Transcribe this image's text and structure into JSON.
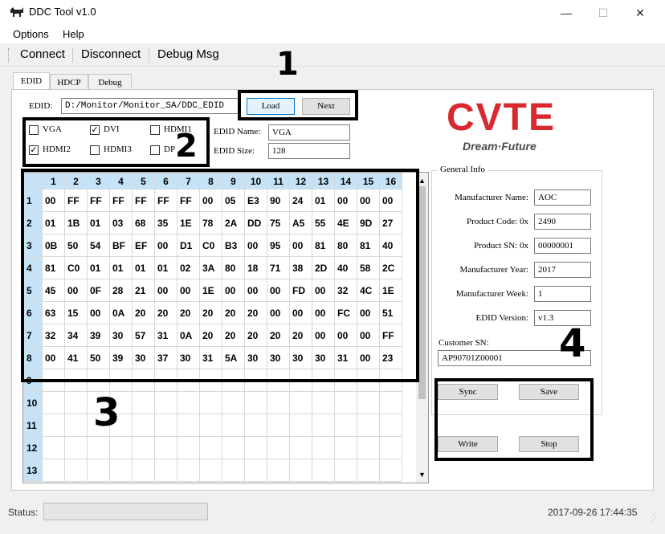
{
  "window": {
    "title": "DDC Tool v1.0",
    "minimize": "—",
    "maximize": "☐",
    "close": "✕"
  },
  "menu": [
    "Options",
    "Help"
  ],
  "toolbar": [
    "Connect",
    "Disconnect",
    "Debug Msg"
  ],
  "tabs": [
    "EDID",
    "HDCP",
    "Debug"
  ],
  "edid": {
    "path_label": "EDID:",
    "path_value": "D:/Monitor/Monitor_SA/DDC_EDID",
    "load": "Load",
    "next": "Next",
    "name_label": "EDID Name:",
    "name_value": "VGA",
    "size_label": "EDID Size:",
    "size_value": "128"
  },
  "ports": [
    {
      "label": "VGA",
      "checked": false
    },
    {
      "label": "DVI",
      "checked": true
    },
    {
      "label": "HDMI1",
      "checked": false
    },
    {
      "label": "HDMI2",
      "checked": true
    },
    {
      "label": "HDMI3",
      "checked": false
    },
    {
      "label": "DP",
      "checked": false
    }
  ],
  "logo": {
    "brand": "CVTE",
    "tagline": "Dream·Future",
    "color": "#d9282f"
  },
  "grid": {
    "columns": [
      "1",
      "2",
      "3",
      "4",
      "5",
      "6",
      "7",
      "8",
      "9",
      "10",
      "11",
      "12",
      "13",
      "14",
      "15",
      "16"
    ],
    "rows": [
      {
        "label": "1",
        "cells": [
          "00",
          "FF",
          "FF",
          "FF",
          "FF",
          "FF",
          "FF",
          "00",
          "05",
          "E3",
          "90",
          "24",
          "01",
          "00",
          "00",
          "00"
        ]
      },
      {
        "label": "2",
        "cells": [
          "01",
          "1B",
          "01",
          "03",
          "68",
          "35",
          "1E",
          "78",
          "2A",
          "DD",
          "75",
          "A5",
          "55",
          "4E",
          "9D",
          "27"
        ]
      },
      {
        "label": "3",
        "cells": [
          "0B",
          "50",
          "54",
          "BF",
          "EF",
          "00",
          "D1",
          "C0",
          "B3",
          "00",
          "95",
          "00",
          "81",
          "80",
          "81",
          "40"
        ]
      },
      {
        "label": "4",
        "cells": [
          "81",
          "C0",
          "01",
          "01",
          "01",
          "01",
          "02",
          "3A",
          "80",
          "18",
          "71",
          "38",
          "2D",
          "40",
          "58",
          "2C"
        ]
      },
      {
        "label": "5",
        "cells": [
          "45",
          "00",
          "0F",
          "28",
          "21",
          "00",
          "00",
          "1E",
          "00",
          "00",
          "00",
          "FD",
          "00",
          "32",
          "4C",
          "1E"
        ]
      },
      {
        "label": "6",
        "cells": [
          "63",
          "15",
          "00",
          "0A",
          "20",
          "20",
          "20",
          "20",
          "20",
          "20",
          "00",
          "00",
          "00",
          "FC",
          "00",
          "51"
        ]
      },
      {
        "label": "7",
        "cells": [
          "32",
          "34",
          "39",
          "30",
          "57",
          "31",
          "0A",
          "20",
          "20",
          "20",
          "20",
          "20",
          "00",
          "00",
          "00",
          "FF"
        ]
      },
      {
        "label": "8",
        "cells": [
          "00",
          "41",
          "50",
          "39",
          "30",
          "37",
          "30",
          "31",
          "5A",
          "30",
          "30",
          "30",
          "30",
          "31",
          "00",
          "23"
        ]
      },
      {
        "label": "9",
        "cells": [
          "",
          "",
          "",
          "",
          "",
          "",
          "",
          "",
          "",
          "",
          "",
          "",
          "",
          "",
          "",
          ""
        ]
      },
      {
        "label": "10",
        "cells": [
          "",
          "",
          "",
          "",
          "",
          "",
          "",
          "",
          "",
          "",
          "",
          "",
          "",
          "",
          "",
          ""
        ]
      },
      {
        "label": "11",
        "cells": [
          "",
          "",
          "",
          "",
          "",
          "",
          "",
          "",
          "",
          "",
          "",
          "",
          "",
          "",
          "",
          ""
        ]
      },
      {
        "label": "12",
        "cells": [
          "",
          "",
          "",
          "",
          "",
          "",
          "",
          "",
          "",
          "",
          "",
          "",
          "",
          "",
          "",
          ""
        ]
      },
      {
        "label": "13",
        "cells": [
          "",
          "",
          "",
          "",
          "",
          "",
          "",
          "",
          "",
          "",
          "",
          "",
          "",
          "",
          "",
          ""
        ]
      }
    ]
  },
  "general_info": {
    "title": "General Info",
    "fields": [
      {
        "label": "Manufacturer Name:",
        "value": "AOC"
      },
      {
        "label": "Product Code: 0x",
        "value": "2490"
      },
      {
        "label": "Product SN: 0x",
        "value": "00000001"
      },
      {
        "label": "Manufacturer Year:",
        "value": "2017"
      },
      {
        "label": "Manufacturer Week:",
        "value": "1"
      },
      {
        "label": "EDID Version:",
        "value": "v1.3"
      }
    ],
    "customer_sn_label": "Customer SN:",
    "customer_sn_value": "AP90701Z00001"
  },
  "actions": {
    "sync": "Sync",
    "save": "Save",
    "write": "Write",
    "stop": "Stop"
  },
  "annotations": [
    "1",
    "2",
    "3",
    "4"
  ],
  "status": {
    "label": "Status:",
    "value": "",
    "timestamp": "2017-09-26 17:44:35"
  }
}
